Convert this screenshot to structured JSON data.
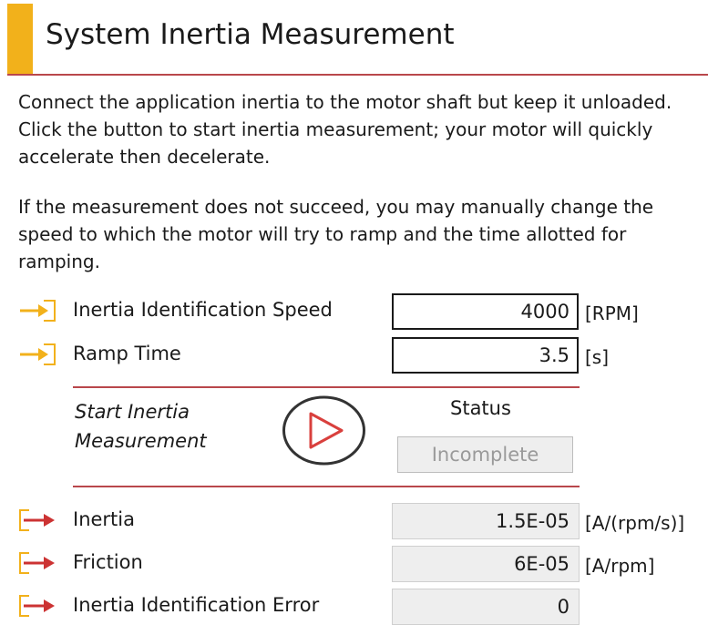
{
  "header": {
    "title": "System Inertia Measurement"
  },
  "instructions": {
    "p1": "Connect the application inertia to the motor shaft but keep it unloaded. Click the button to start inertia measurement; your motor will quickly accelerate then decelerate.",
    "p2": "If the measurement does not succeed, you may manually change the speed to which the motor will try to ramp and the time allotted for ramping."
  },
  "inputs": [
    {
      "label": "Inertia Identification Speed",
      "value": "4000",
      "unit": "[RPM]",
      "icon": "input-arrow-icon"
    },
    {
      "label": "Ramp Time",
      "value": "3.5",
      "unit": "[s]",
      "icon": "input-arrow-icon"
    }
  ],
  "measurement": {
    "start_label": "Start Inertia Measurement",
    "status_label": "Status",
    "status_value": "Incomplete",
    "play_icon": "play-icon"
  },
  "outputs": [
    {
      "label": "Inertia",
      "value": "1.5E-05",
      "unit": "[A/(rpm/s)]",
      "icon": "output-arrow-icon"
    },
    {
      "label": "Friction",
      "value": "6E-05",
      "unit": "[A/rpm]",
      "icon": "output-arrow-icon"
    },
    {
      "label": "Inertia Identification Error",
      "value": "0",
      "unit": "",
      "icon": "output-arrow-icon"
    }
  ],
  "colors": {
    "accent": "#f2b11b",
    "rule": "#b9474b",
    "input_arrow": "#f2b11b",
    "output_arrow": "#cc3333",
    "play": "#d9403d"
  }
}
